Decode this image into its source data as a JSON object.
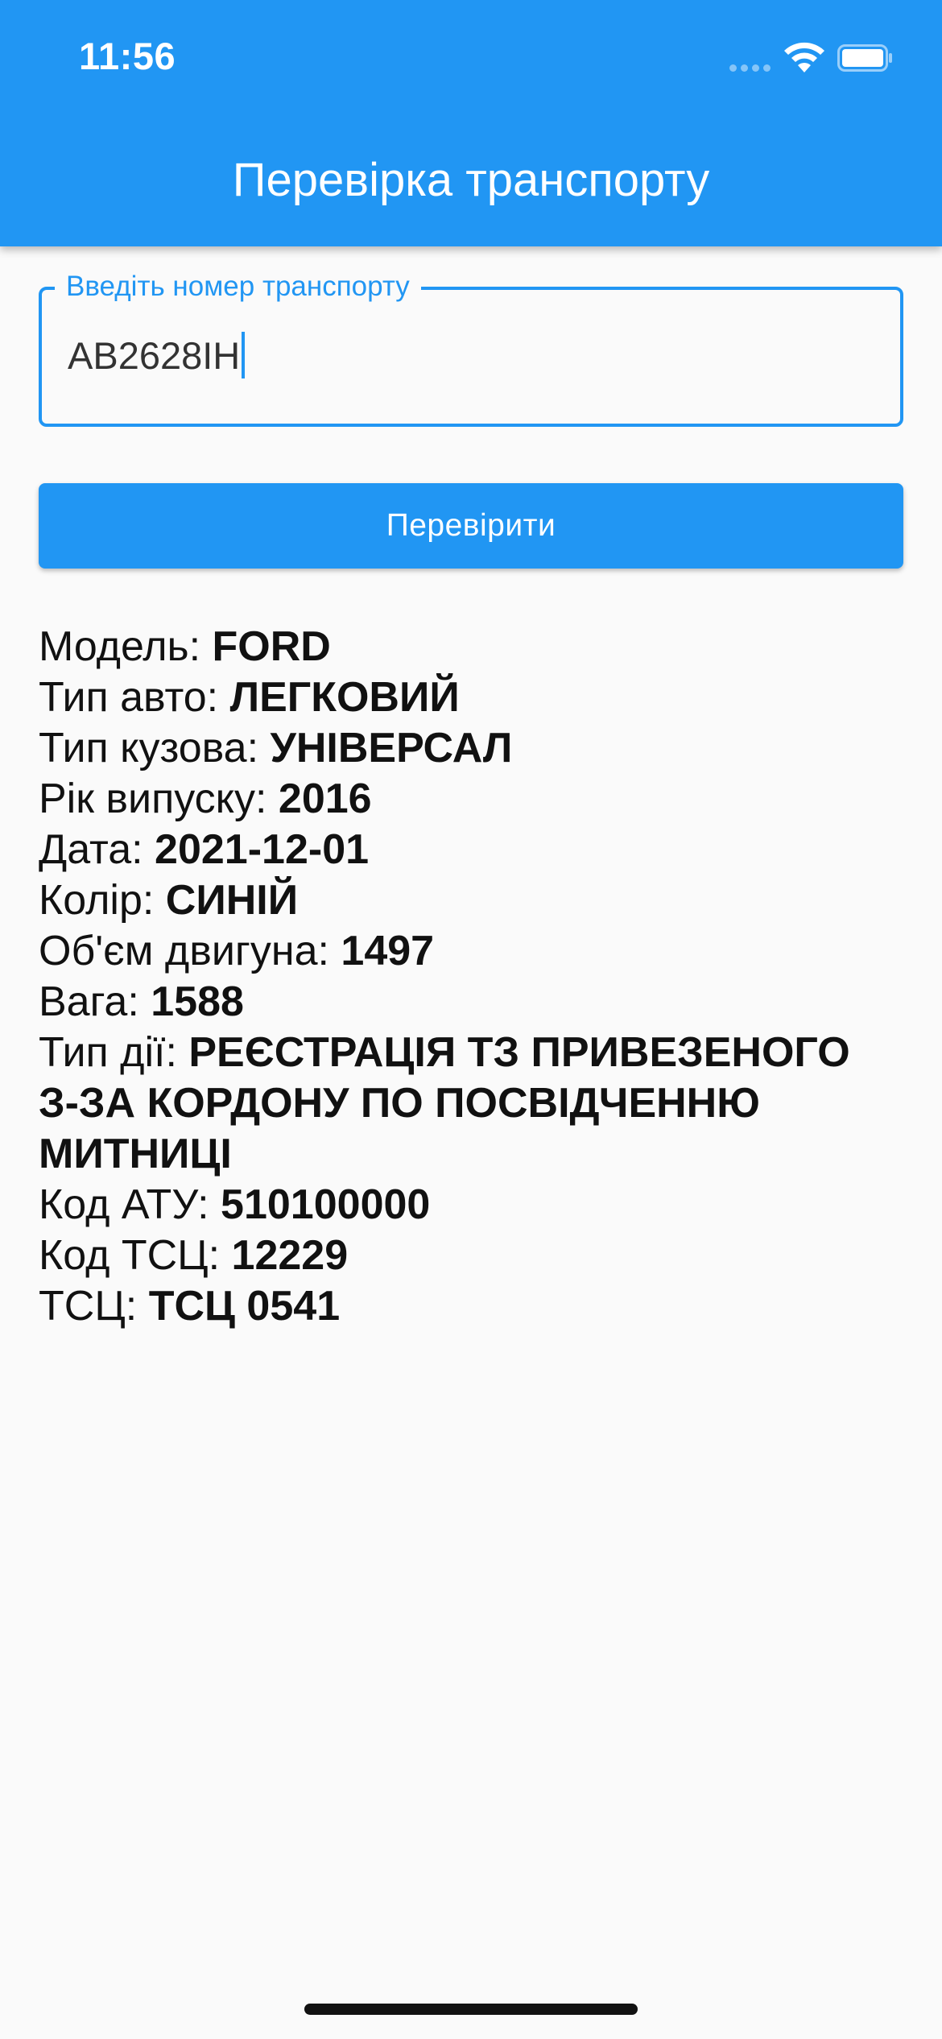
{
  "status_bar": {
    "time": "11:56"
  },
  "app_bar": {
    "title": "Перевірка транспорту",
    "color": "#2196F3"
  },
  "search": {
    "label": "Введіть номер транспорту",
    "value": "AB2628IH"
  },
  "check_button": {
    "label": "Перевірити"
  },
  "vehicle_info": [
    {
      "label": "Модель:",
      "value": "FORD"
    },
    {
      "label": "Тип авто:",
      "value": "ЛЕГКОВИЙ"
    },
    {
      "label": "Тип кузова:",
      "value": "УНІВЕРСАЛ"
    },
    {
      "label": "Рік випуску:",
      "value": "2016"
    },
    {
      "label": "Дата:",
      "value": "2021-12-01"
    },
    {
      "label": "Колір:",
      "value": "СИНІЙ"
    },
    {
      "label": "Об'єм двигуна:",
      "value": "1497"
    },
    {
      "label": "Вага:",
      "value": "1588"
    },
    {
      "label": "Тип дії:",
      "value": "РЕЄСТРАЦІЯ ТЗ ПРИВЕЗЕНОГО З-ЗА КОРДОНУ ПО ПОСВІДЧЕННЮ МИТНИЦІ"
    },
    {
      "label": "Код АТУ:",
      "value": "510100000"
    },
    {
      "label": "Код ТСЦ:",
      "value": "12229"
    },
    {
      "label": "ТСЦ:",
      "value": "ТСЦ 0541"
    }
  ],
  "icons": [
    "signal-icon",
    "wifi-icon",
    "battery-icon"
  ]
}
